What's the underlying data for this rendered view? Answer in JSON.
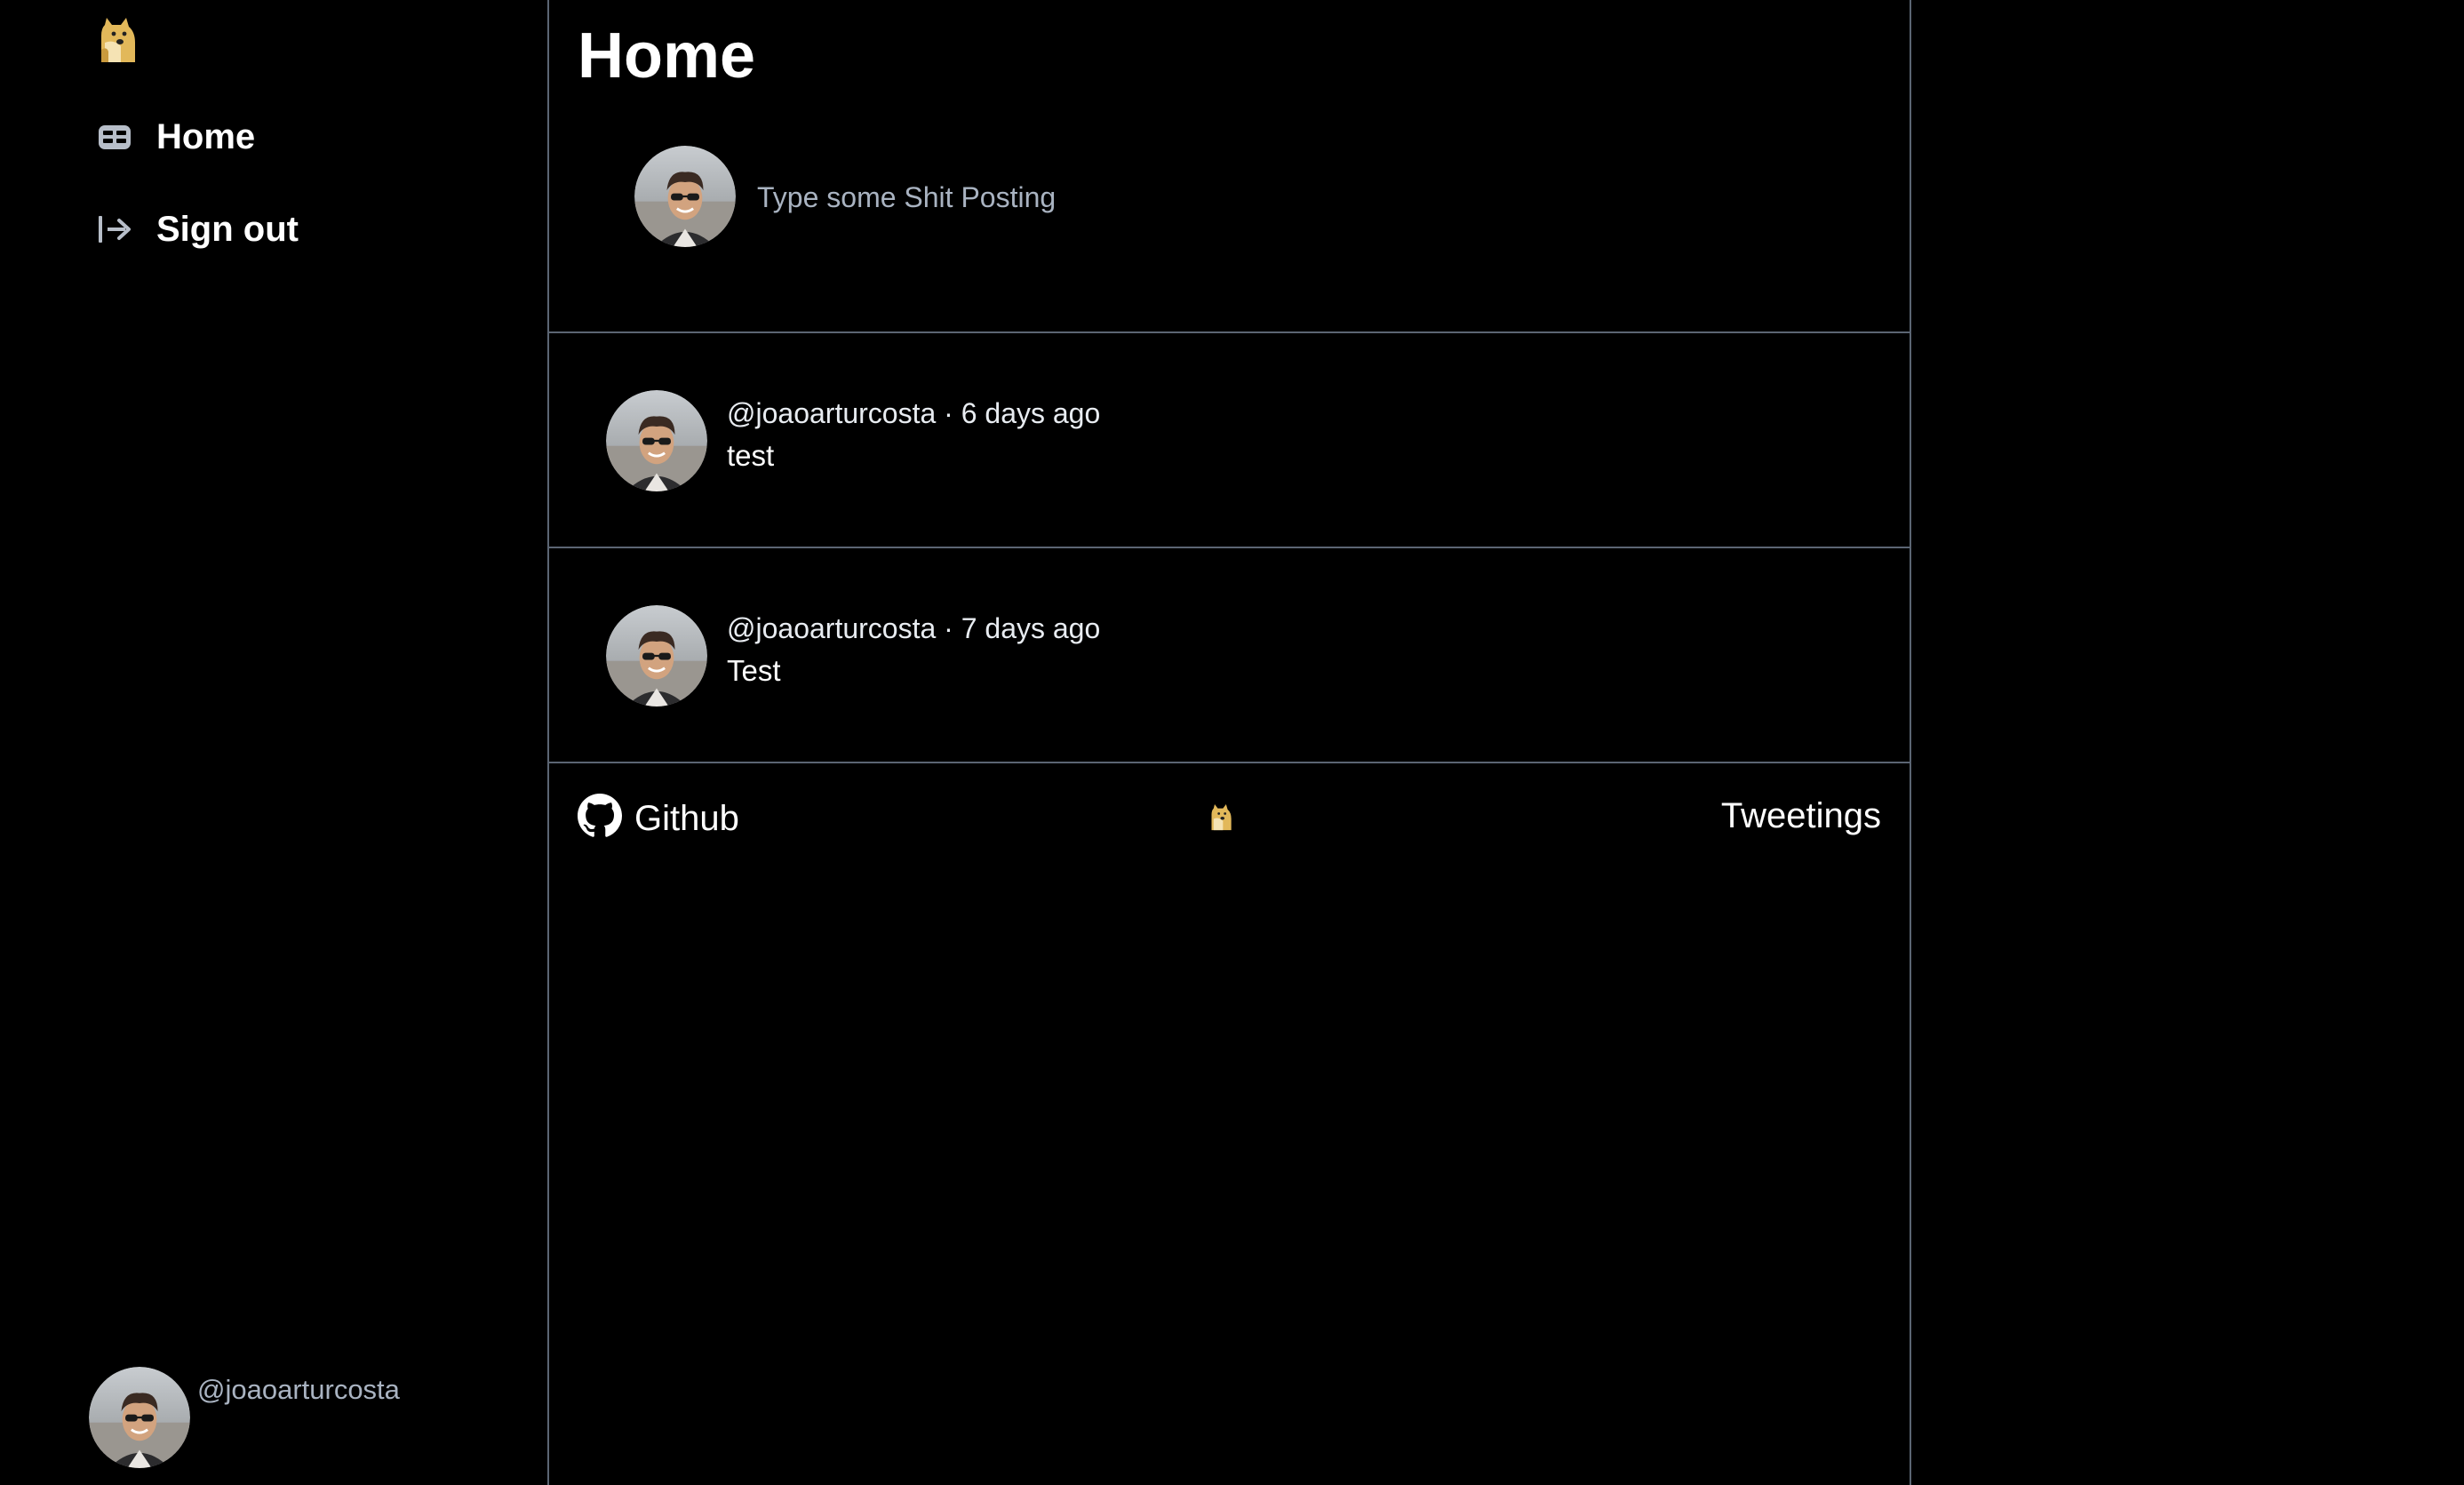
{
  "sidebar": {
    "logo_icon": "doge-logo-icon",
    "items": [
      {
        "label": "Home",
        "icon": "home-feed-icon"
      },
      {
        "label": "Sign out",
        "icon": "sign-out-icon"
      }
    ],
    "user": {
      "handle": "@joaoarturcosta",
      "avatar": "user-avatar"
    }
  },
  "main": {
    "title": "Home",
    "composer": {
      "placeholder": "Type some Shit Posting",
      "value": ""
    },
    "posts": [
      {
        "meta": "@joaoarturcosta · 6 days ago",
        "text": "test"
      },
      {
        "meta": "@joaoarturcosta · 7 days ago",
        "text": "Test"
      }
    ]
  },
  "footer": {
    "github_label": "Github",
    "github_icon": "github-icon",
    "logo_icon": "doge-logo-icon",
    "brand_label": "Tweetings"
  },
  "colors": {
    "background": "#000000",
    "border": "#5b6573",
    "muted_text": "#a9b3c1",
    "text": "#ffffff"
  }
}
